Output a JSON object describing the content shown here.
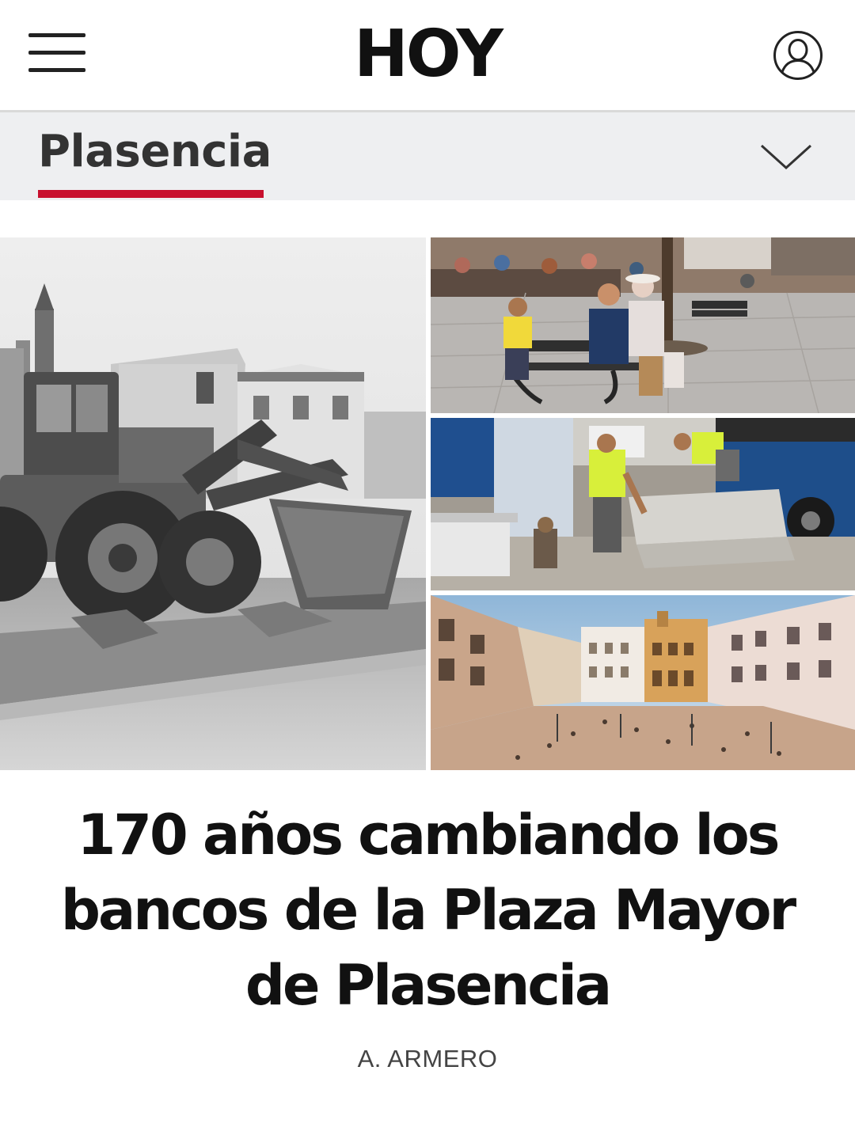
{
  "header": {
    "logo": "HOY",
    "menu_icon": "hamburger-menu-icon",
    "user_icon": "user-account-icon"
  },
  "section": {
    "name": "Plasencia",
    "toggle_icon": "chevron-down-icon",
    "accent_color": "#c8102e"
  },
  "article": {
    "title": "170 años cambiando los bancos de la Plaza Mayor de Plasencia",
    "byline": "A. ARMERO"
  }
}
